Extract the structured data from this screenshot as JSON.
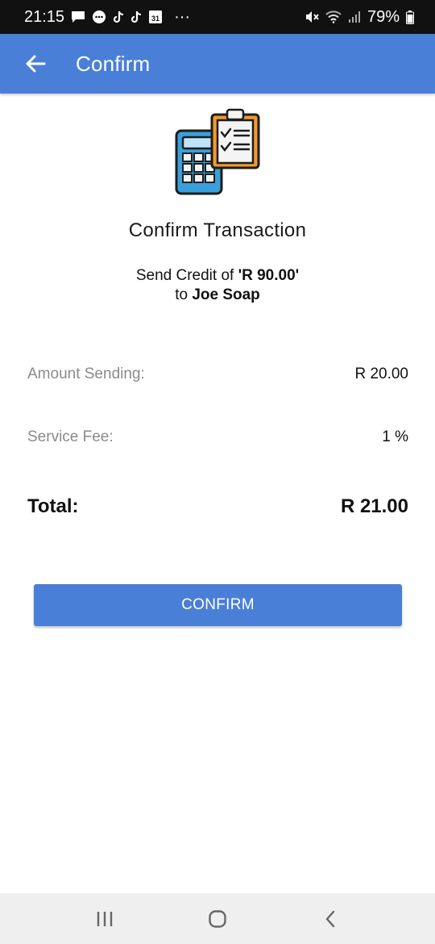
{
  "status_bar": {
    "time": "21:15",
    "notification_icons": [
      "message-icon",
      "chat-bubble-icon",
      "tiktok-icon",
      "tiktok-icon",
      "calendar-icon"
    ],
    "calendar_day": "31",
    "more": "···",
    "battery": "79%"
  },
  "app_bar": {
    "title": "Confirm",
    "color": "#4a7fd8"
  },
  "content": {
    "icon": "calculator-clipboard-icon",
    "heading": "Confirm Transaction",
    "send_prefix": "Send Credit of ",
    "send_amount": "'R 90.00'",
    "to_prefix": "to ",
    "recipient": "Joe Soap"
  },
  "details": {
    "amount_label": "Amount Sending:",
    "amount_value": "R 20.00",
    "fee_label": "Service Fee:",
    "fee_value": "1 %",
    "total_label": "Total:",
    "total_value": "R 21.00"
  },
  "actions": {
    "confirm_label": "CONFIRM"
  },
  "nav_bar": {
    "icons": [
      "recents-icon",
      "home-icon",
      "back-icon"
    ]
  }
}
